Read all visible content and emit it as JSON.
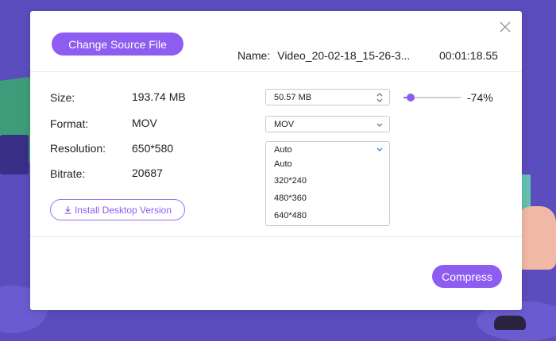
{
  "dialog": {
    "change_source_label": "Change Source File",
    "name_label": "Name:",
    "file_name": "Video_20-02-18_15-26-3...",
    "duration": "00:01:18.55",
    "install_label": "Install Desktop Version",
    "compress_label": "Compress"
  },
  "info": {
    "size_label": "Size:",
    "size_value": "193.74 MB",
    "format_label": "Format:",
    "format_value": "MOV",
    "resolution_label": "Resolution:",
    "resolution_value": "650*580",
    "bitrate_label": "Bitrate:",
    "bitrate_value": "20687"
  },
  "output": {
    "size_value": "50.57  MB",
    "percent": "-74%",
    "slider_fraction": 0.12,
    "format_value": "MOV",
    "resolution_selected": "Auto",
    "resolution_options": [
      "Auto",
      "320*240",
      "480*360",
      "640*480"
    ]
  },
  "colors": {
    "accent": "#8e5cf0",
    "background": "#5b4dbd"
  },
  "icons": {
    "close": "close-icon",
    "stepper": "stepper-arrows-icon",
    "dropdown": "chevron-down-icon",
    "download": "download-icon"
  }
}
